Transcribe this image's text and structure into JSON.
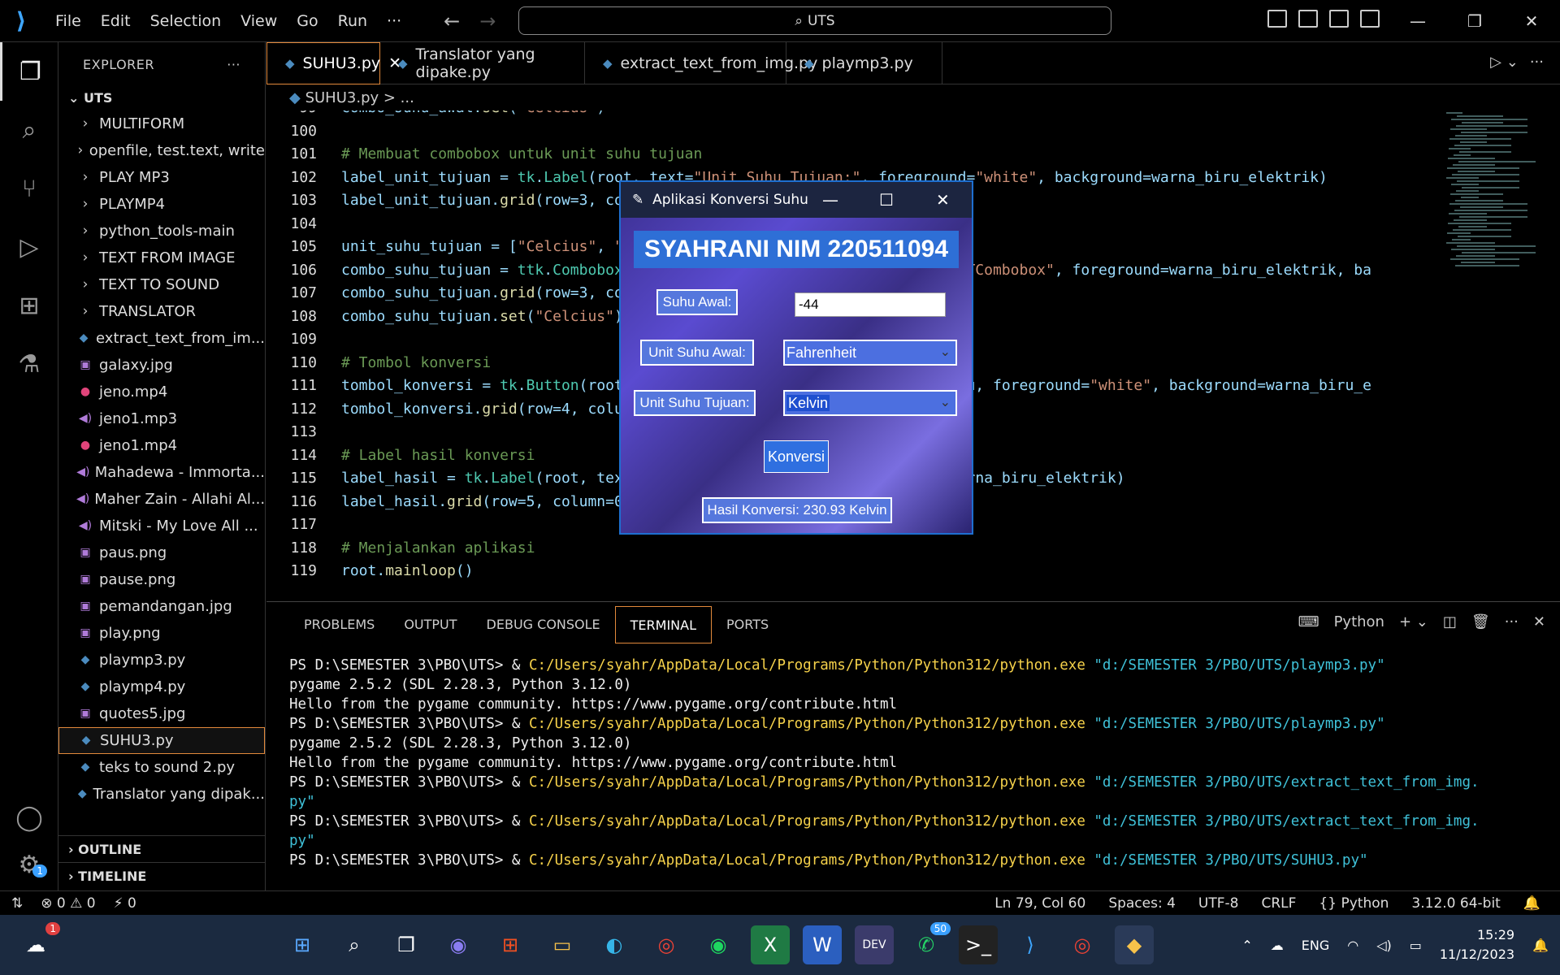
{
  "titlebar": {
    "menu": [
      "File",
      "Edit",
      "Selection",
      "View",
      "Go",
      "Run",
      "···"
    ],
    "search": "UTS"
  },
  "explorer": {
    "header": "EXPLORER",
    "more": "···",
    "root": "UTS",
    "folders": [
      "MULTIFORM",
      "openfile, test.text, write",
      "PLAY MP3",
      "PLAYMP4",
      "python_tools-main",
      "TEXT FROM IMAGE",
      "TEXT TO SOUND",
      "TRANSLATOR"
    ],
    "files": [
      {
        "name": "extract_text_from_im...",
        "type": "py"
      },
      {
        "name": "galaxy.jpg",
        "type": "img"
      },
      {
        "name": "jeno.mp4",
        "type": "mp4"
      },
      {
        "name": "jeno1.mp3",
        "type": "mp3"
      },
      {
        "name": "jeno1.mp4",
        "type": "mp4"
      },
      {
        "name": "Mahadewa - Immorta...",
        "type": "mp3"
      },
      {
        "name": "Maher Zain - Allahi Al...",
        "type": "mp3"
      },
      {
        "name": "Mitski - My Love All ...",
        "type": "mp3"
      },
      {
        "name": "paus.png",
        "type": "img"
      },
      {
        "name": "pause.png",
        "type": "img"
      },
      {
        "name": "pemandangan.jpg",
        "type": "img"
      },
      {
        "name": "play.png",
        "type": "img"
      },
      {
        "name": "playmp3.py",
        "type": "py"
      },
      {
        "name": "playmp4.py",
        "type": "py"
      },
      {
        "name": "quotes5.jpg",
        "type": "img"
      },
      {
        "name": "SUHU3.py",
        "type": "py"
      },
      {
        "name": "teks to sound 2.py",
        "type": "py"
      },
      {
        "name": "Translator yang dipak...",
        "type": "py"
      }
    ],
    "outline": "OUTLINE",
    "timeline": "TIMELINE"
  },
  "tabs": [
    "SUHU3.py",
    "Translator yang dipake.py",
    "extract_text_from_img.py",
    "playmp3.py"
  ],
  "breadcrumb": "SUHU3.py > ...",
  "code": [
    {
      "n": "99",
      "t": "combo_suhu_awal.set(\"Celcius\")"
    },
    {
      "n": "100",
      "t": ""
    },
    {
      "n": "101",
      "t": "# Membuat combobox untuk unit suhu tujuan"
    },
    {
      "n": "102",
      "t": "label_unit_tujuan = tk.Label(root, text=\"Unit Suhu Tujuan:\", foreground=\"white\", background=warna_biru_elektrik)"
    },
    {
      "n": "103",
      "t": "label_unit_tujuan.grid(row=3, column=0, padx=10, pady=10)"
    },
    {
      "n": "104",
      "t": ""
    },
    {
      "n": "105",
      "t": "unit_suhu_tujuan = [\"Celcius\", \"Fahrenheit\", \"Kelvin\"]"
    },
    {
      "n": "106",
      "t": "combo_suhu_tujuan = ttk.Combobox(root, values=unit_suhu_tujuan, style=\"TCombobox\", foreground=warna_biru_elektrik, ba"
    },
    {
      "n": "107",
      "t": "combo_suhu_tujuan.grid(row=3, column=1, padx=10, pady=10)"
    },
    {
      "n": "108",
      "t": "combo_suhu_tujuan.set(\"Celcius\")"
    },
    {
      "n": "109",
      "t": ""
    },
    {
      "n": "110",
      "t": "# Tombol konversi"
    },
    {
      "n": "111",
      "t": "tombol_konversi = tk.Button(root, text=\"Konversi\", command=konversi_suhu, foreground=\"white\", background=warna_biru_e"
    },
    {
      "n": "112",
      "t": "tombol_konversi.grid(row=4, column=0, columnspan=2, pady=10)"
    },
    {
      "n": "113",
      "t": ""
    },
    {
      "n": "114",
      "t": "# Label hasil konversi"
    },
    {
      "n": "115",
      "t": "label_hasil = tk.Label(root, text=\"\", foreground=\"white\", background=warna_biru_elektrik)"
    },
    {
      "n": "116",
      "t": "label_hasil.grid(row=5, column=0, columnspan=2, pady=10)"
    },
    {
      "n": "117",
      "t": ""
    },
    {
      "n": "118",
      "t": "# Menjalankan aplikasi"
    },
    {
      "n": "119",
      "t": "root.mainloop()"
    }
  ],
  "panel": {
    "tabs": [
      "PROBLEMS",
      "OUTPUT",
      "DEBUG CONSOLE",
      "TERMINAL",
      "PORTS"
    ],
    "shell": "Python",
    "terminal": [
      {
        "prompt": "PS D:\\SEMESTER 3\\PBO\\UTS> & ",
        "exe": "C:/Users/syahr/AppData/Local/Programs/Python/Python312/python.exe",
        "arg": " \"d:/SEMESTER 3/PBO/UTS/playmp3.py\""
      },
      {
        "text": "pygame 2.5.2 (SDL 2.28.3, Python 3.12.0)"
      },
      {
        "text": "Hello from the pygame community. https://www.pygame.org/contribute.html"
      },
      {
        "prompt": "PS D:\\SEMESTER 3\\PBO\\UTS> & ",
        "exe": "C:/Users/syahr/AppData/Local/Programs/Python/Python312/python.exe",
        "arg": " \"d:/SEMESTER 3/PBO/UTS/playmp3.py\""
      },
      {
        "text": "pygame 2.5.2 (SDL 2.28.3, Python 3.12.0)"
      },
      {
        "text": "Hello from the pygame community. https://www.pygame.org/contribute.html"
      },
      {
        "prompt": "PS D:\\SEMESTER 3\\PBO\\UTS> & ",
        "exe": "C:/Users/syahr/AppData/Local/Programs/Python/Python312/python.exe",
        "arg": " \"d:/SEMESTER 3/PBO/UTS/extract_text_from_img."
      },
      {
        "arg2": "py\""
      },
      {
        "prompt": "PS D:\\SEMESTER 3\\PBO\\UTS> & ",
        "exe": "C:/Users/syahr/AppData/Local/Programs/Python/Python312/python.exe",
        "arg": " \"d:/SEMESTER 3/PBO/UTS/extract_text_from_img."
      },
      {
        "arg2": "py\""
      },
      {
        "prompt": "PS D:\\SEMESTER 3\\PBO\\UTS> & ",
        "exe": "C:/Users/syahr/AppData/Local/Programs/Python/Python312/python.exe",
        "arg": " \"d:/SEMESTER 3/PBO/UTS/SUHU3.py\""
      }
    ]
  },
  "statusbar": {
    "errors": "0",
    "warnings": "0",
    "ports": "0",
    "position": "Ln 79, Col 60",
    "spaces": "Spaces: 4",
    "encoding": "UTF-8",
    "eol": "CRLF",
    "language": "Python",
    "interpreter": "3.12.0 64-bit"
  },
  "dialog": {
    "title": "Aplikasi Konversi Suhu",
    "heading": "SYAHRANI NIM 220511094",
    "suhu_awal_label": "Suhu Awal:",
    "suhu_awal_value": "-44",
    "unit_awal_label": "Unit Suhu Awal:",
    "unit_awal_value": "Fahrenheit",
    "unit_tujuan_label": "Unit Suhu Tujuan:",
    "unit_tujuan_value": "Kelvin",
    "button": "Konversi",
    "result": "Hasil Konversi: 230.93 Kelvin"
  },
  "taskbar": {
    "weather_badge": "1",
    "whatsapp_badge": "50",
    "lang": "ENG",
    "time": "15:29",
    "date": "11/12/2023",
    "settings_badge": "1"
  }
}
